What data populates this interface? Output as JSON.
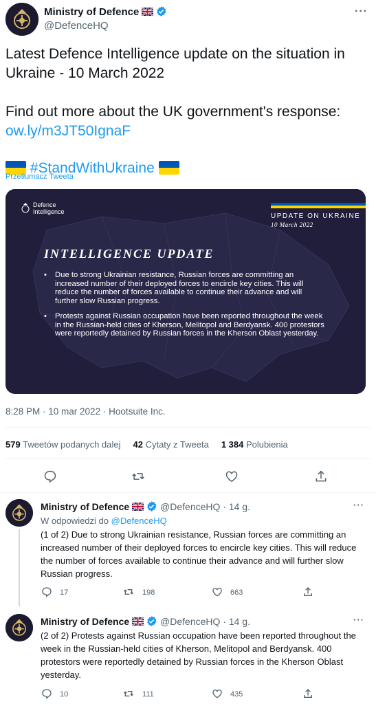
{
  "main_tweet": {
    "author_name": "Ministry of Defence",
    "author_handle": "@DefenceHQ",
    "more": "···",
    "text_line1": "Latest Defence Intelligence update on the situation in Ukraine - 10 March 2022",
    "text_line2_prefix": "Find out more about the UK government's response:",
    "link": "ow.ly/m3JT50IgnaF",
    "hashtag": "#StandWithUkraine",
    "translate": "Przetłumacz Tweeta",
    "media": {
      "logo_line1": "Defence",
      "logo_line2": "Intelligence",
      "update_label": "UPDATE ON UKRAINE",
      "update_date": "10 March 2022",
      "title": "INTELLIGENCE UPDATE",
      "bullets": [
        "Due to strong Ukrainian resistance, Russian forces are committing an increased number of their deployed forces to encircle key cities. This will reduce the number of forces available to continue their advance and will further slow Russian progress.",
        "Protests against Russian occupation have been reported throughout the week in the Russian-held cities of Kherson, Melitopol and Berdyansk. 400 protestors were reportedly detained by Russian forces in the Kherson Oblast yesterday."
      ]
    },
    "meta": "8:28 PM · 10 mar 2022 · Hootsuite Inc.",
    "stats": {
      "retweets_count": "579",
      "retweets_label": "Tweetów podanych dalej",
      "quotes_count": "42",
      "quotes_label": "Cytaty z Tweeta",
      "likes_count": "1 384",
      "likes_label": "Polubienia"
    }
  },
  "replies": [
    {
      "author_name": "Ministry of Defence",
      "author_handle": "@DefenceHQ",
      "time": "· 14 g.",
      "reply_prefix": "W odpowiedzi do",
      "reply_handle": "@DefenceHQ",
      "text": "(1 of 2) Due to strong Ukrainian resistance, Russian forces are committing an increased number of their deployed forces to encircle key cities. This will reduce the number of forces available to continue their advance and will further slow Russian progress.",
      "replies": "17",
      "retweets": "198",
      "likes": "663"
    },
    {
      "author_name": "Ministry of Defence",
      "author_handle": "@DefenceHQ",
      "time": "· 14 g.",
      "text": "(2 of 2) Protests against Russian occupation have been reported throughout the week in the Russian-held cities of Kherson, Melitopol and Berdyansk. 400 protestors were reportedly detained by Russian forces in the Kherson Oblast yesterday.",
      "replies": "10",
      "retweets": "111",
      "likes": "435"
    }
  ],
  "colors": {
    "link": "#1d9bf0",
    "secondary_text": "#536471",
    "media_bg": "#201e3a",
    "ukraine_blue": "#0057b7",
    "ukraine_yellow": "#ffd700"
  }
}
